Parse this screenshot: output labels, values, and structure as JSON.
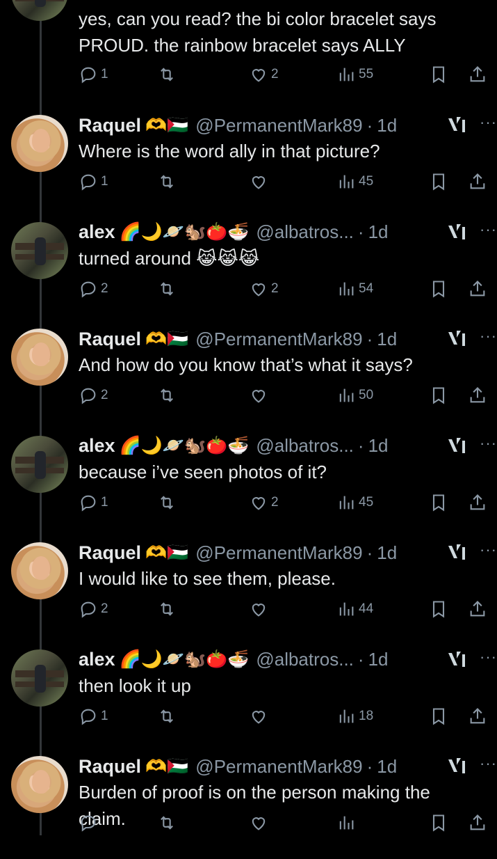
{
  "top": {
    "body": "yes, can you read? the bi color bracelet says PROUD. the rainbow bracelet says ALLY",
    "body_line1": "yes, can you read? the bi color bracelet says",
    "body_line2": "PROUD. the rainbow bracelet says ALLY",
    "replies": "1",
    "likes": "2",
    "views": "55"
  },
  "tweets": [
    {
      "name": "Raquel",
      "emoji": "🫶🇵🇸",
      "handle": "@PermanentMark89",
      "time": "1d",
      "line1": "Where is the word ally in that picture?",
      "line2": "",
      "replies": "1",
      "likes": "",
      "views": "45"
    },
    {
      "name": "alex",
      "emoji": "🌈🌙🪐🐿️🍅🍜",
      "handle": "@albatros...",
      "time": "1d",
      "line1": "turned around 😹😹😹",
      "line2": "",
      "replies": "2",
      "likes": "2",
      "views": "54"
    },
    {
      "name": "Raquel",
      "emoji": "🫶🇵🇸",
      "handle": "@PermanentMark89",
      "time": "1d",
      "line1": "And how do you know that’s what it says?",
      "line2": "",
      "replies": "2",
      "likes": "",
      "views": "50"
    },
    {
      "name": "alex",
      "emoji": "🌈🌙🪐🐿️🍅🍜",
      "handle": "@albatros...",
      "time": "1d",
      "line1": "because i’ve seen photos of it?",
      "line2": "",
      "replies": "1",
      "likes": "2",
      "views": "45"
    },
    {
      "name": "Raquel",
      "emoji": "🫶🇵🇸",
      "handle": "@PermanentMark89",
      "time": "1d",
      "line1": "I would like to see them, please.",
      "line2": "",
      "replies": "2",
      "likes": "",
      "views": "44"
    },
    {
      "name": "alex",
      "emoji": "🌈🌙🪐🐿️🍅🍜",
      "handle": "@albatros...",
      "time": "1d",
      "line1": "then look it up",
      "line2": "",
      "replies": "1",
      "likes": "",
      "views": "18"
    },
    {
      "name": "Raquel",
      "emoji": "🫶🇵🇸",
      "handle": "@PermanentMark89",
      "time": "1d",
      "line1": "Burden of proof is on the person making the",
      "line2": "claim.",
      "replies": "",
      "likes": "",
      "views": ""
    }
  ],
  "separator": "·",
  "more_label": "···",
  "colors": {
    "background": "#000000",
    "text": "#e7e9ea",
    "muted": "#8b98a5",
    "thread": "#333639"
  }
}
